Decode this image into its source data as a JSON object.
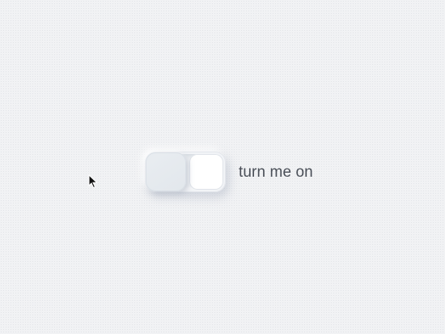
{
  "toggle": {
    "label": "turn me on",
    "state": "off",
    "colors": {
      "background": "#f1f2f4",
      "knob": "#e6eaee",
      "track": "#ffffff",
      "label": "#4a4f58"
    }
  },
  "cursor": {
    "icon": "mouse-pointer-icon"
  }
}
